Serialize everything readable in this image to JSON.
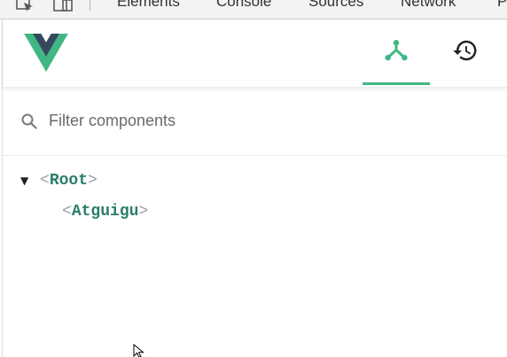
{
  "devtools": {
    "tabs": [
      "Elements",
      "Console",
      "Sources",
      "Network",
      "P"
    ],
    "active_tab": "Vue"
  },
  "vue_header": {
    "logo": "vue-logo",
    "components_button": "components-icon",
    "history_button": "history-icon",
    "active": "components"
  },
  "filter": {
    "placeholder": "Filter components",
    "value": ""
  },
  "tree": {
    "root": {
      "open_bracket": "<",
      "name": "Root",
      "close_bracket": ">",
      "expanded": true
    },
    "child": {
      "open_bracket": "<",
      "name": "Atguigu",
      "close_bracket": ">"
    }
  },
  "colors": {
    "accent": "#41b883",
    "logo_dark": "#35495e",
    "tag_name": "#2c7d6a",
    "bracket": "#9aa0a6"
  }
}
